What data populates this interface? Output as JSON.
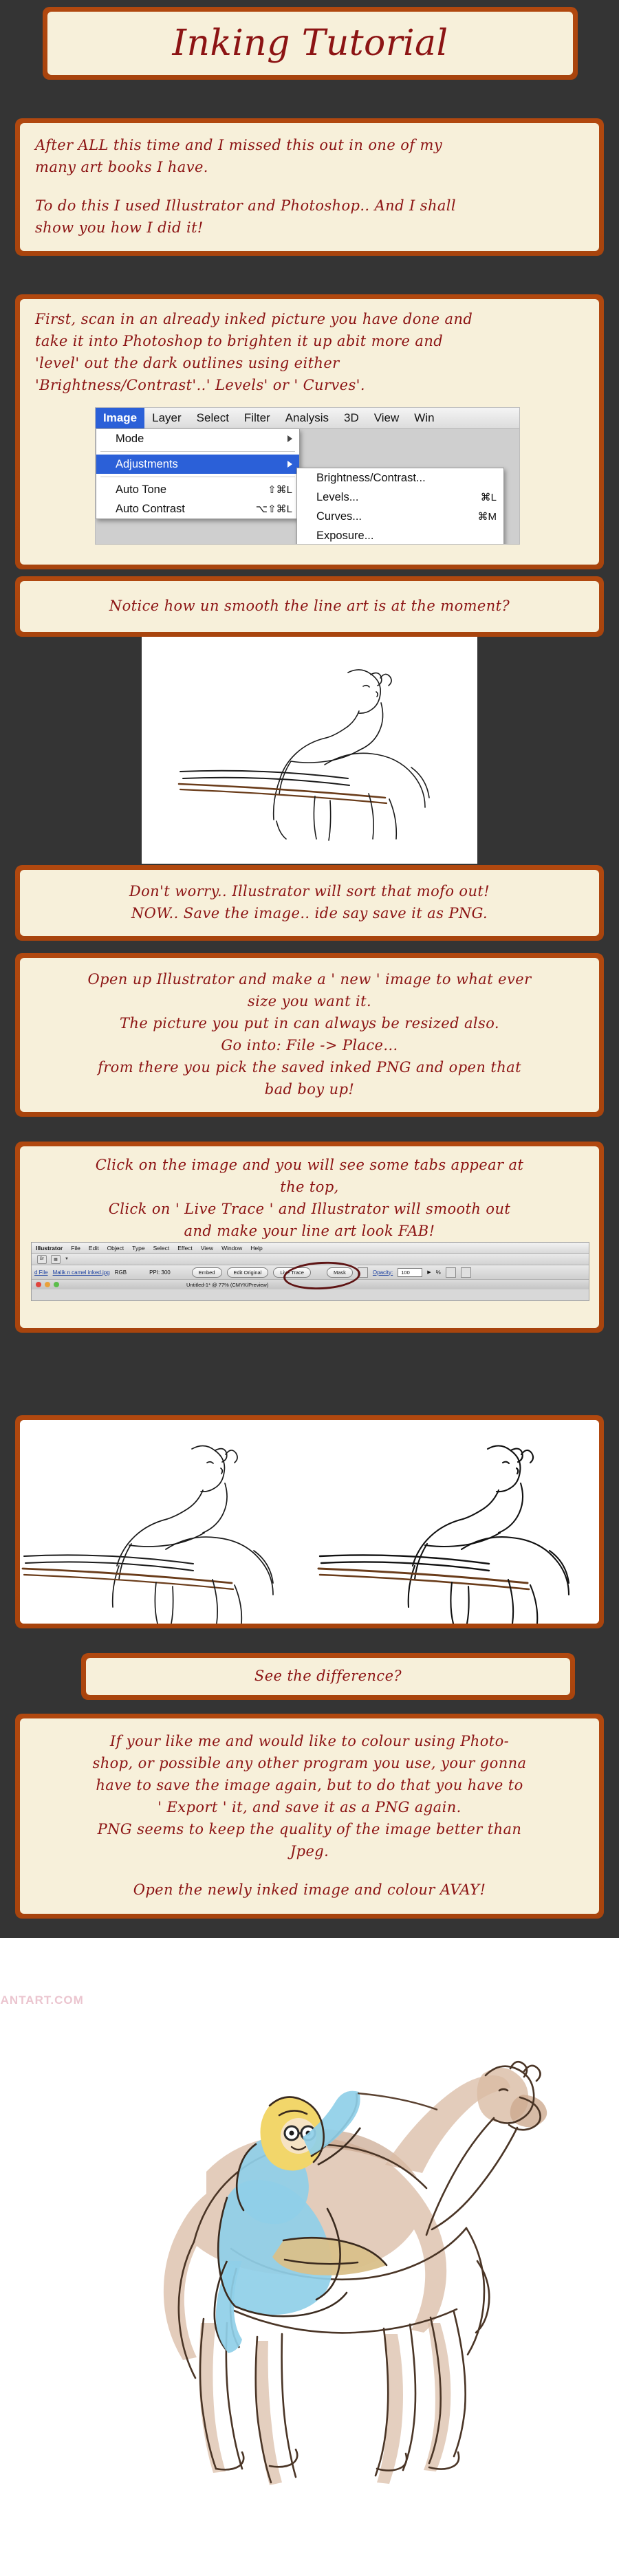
{
  "meta": {
    "bg_color": "#343434",
    "frame_color": "#b3490f",
    "paper_color": "#f7f0da",
    "ink_color": "#8c1414"
  },
  "title": {
    "text": "Inking Tutorial"
  },
  "blocks": {
    "intro": {
      "line1": "After ALL this time and I missed this out in one of my",
      "line2": "many art books I have.",
      "line3": "To do this I used Illustrator and Photoshop.. And I shall",
      "line4": "show you how I did it!"
    },
    "step_scan": {
      "line1": "First, scan in an already inked picture you have done and",
      "line2": "take it into Photoshop to brighten it up abit more and",
      "line3": "'level' out the dark outlines using either",
      "line4": "'Brightness/Contrast'..' Levels' or ' Curves'."
    },
    "notice": {
      "line1": "Notice how un smooth the line art is at the moment?"
    },
    "dont_worry": {
      "line1": "Don't worry.. Illustrator will sort that mofo out!",
      "line2": "NOW.. Save the image.. ide say save it as PNG."
    },
    "open_illustrator": {
      "line1": "Open up Illustrator and make a ' new ' image to what ever",
      "line2": "size you want it.",
      "line3": "The picture you put in can always be resized also.",
      "line4": "Go into:   File -> Place...",
      "line5": "from there you pick the saved inked PNG and open that",
      "line6": "bad boy up!"
    },
    "live_trace": {
      "line1": "Click on the image and you will see some tabs appear at",
      "line2": "the top,",
      "line3": "Click on ' Live Trace ' and Illustrator will smooth out",
      "line4": "and make your line art look FAB!"
    },
    "difference": {
      "line1": "See the difference?"
    },
    "export": {
      "line1": "If your like me and would like to colour using Photo-",
      "line2": "shop, or possible any other program you use, your gonna",
      "line3": "have to save the image again, but to do that you have to",
      "line4": "' Export ' it, and save it as a PNG again.",
      "line5": "PNG seems to keep the quality of the image better than",
      "line6": "Jpeg.",
      "line7": "Open the newly inked image and colour AVAY!"
    }
  },
  "photoshop_screenshot": {
    "menubar": [
      "Image",
      "Layer",
      "Select",
      "Filter",
      "Analysis",
      "3D",
      "View",
      "Win"
    ],
    "selected_menu": "Image",
    "dropdown": [
      {
        "label": "Mode",
        "shortcut": "",
        "submenu": true,
        "highlighted": false
      },
      {
        "label": "Adjustments",
        "shortcut": "",
        "submenu": true,
        "highlighted": true
      },
      {
        "label": "Auto Tone",
        "shortcut": "⇧⌘L",
        "submenu": false,
        "highlighted": false
      },
      {
        "label": "Auto Contrast",
        "shortcut": "⌥⇧⌘L",
        "submenu": false,
        "highlighted": false
      }
    ],
    "submenu": [
      {
        "label": "Brightness/Contrast...",
        "shortcut": ""
      },
      {
        "label": "Levels...",
        "shortcut": "⌘L"
      },
      {
        "label": "Curves...",
        "shortcut": "⌘M"
      },
      {
        "label": "Exposure...",
        "shortcut": ""
      }
    ]
  },
  "illustrator_screenshot": {
    "menubar": [
      "Illustrator",
      "File",
      "Edit",
      "Object",
      "Type",
      "Select",
      "Effect",
      "View",
      "Window",
      "Help"
    ],
    "toolbar_icons": [
      "Br",
      "arrange-icon"
    ],
    "control_bar": {
      "file_link_label": "d File",
      "filename": "Malik n camel inked.jpg",
      "colormode": "RGB",
      "ppi": "PPI: 300",
      "buttons": [
        "Embed",
        "Edit Original",
        "Live Trace",
        "Mask"
      ],
      "highlighted_button": "Live Trace",
      "opacity_label": "Opacity:",
      "opacity_value": "100",
      "opacity_unit": "%"
    },
    "document_title": "Untitled-1* @ 77% (CMYK/Preview)"
  },
  "final_illustration": {
    "watermark": "KARASUDEVIANTART.COM",
    "alt": "coloured drawing of a girl in blue robe riding a camel"
  }
}
